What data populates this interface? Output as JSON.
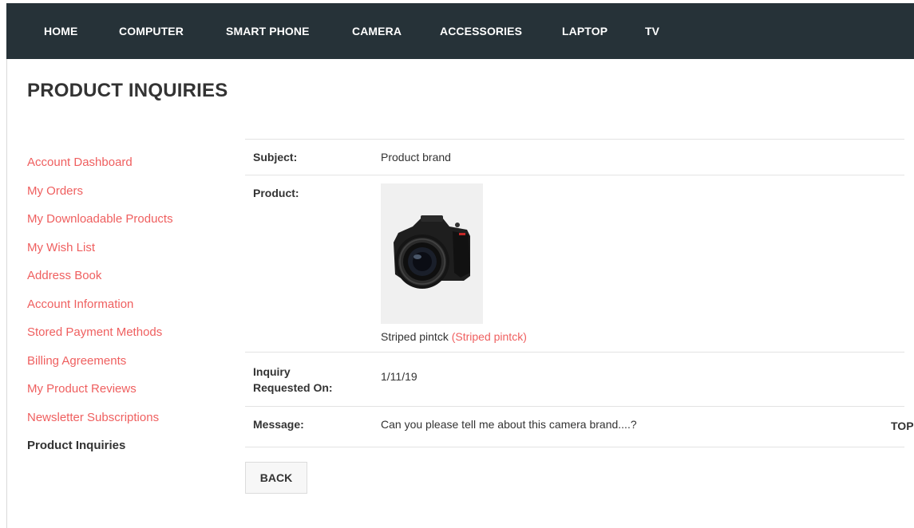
{
  "nav": {
    "items": [
      {
        "label": "HOME"
      },
      {
        "label": "COMPUTER"
      },
      {
        "label": "SMART PHONE"
      },
      {
        "label": "CAMERA"
      },
      {
        "label": "ACCESSORIES"
      },
      {
        "label": "LAPTOP"
      },
      {
        "label": "TV"
      }
    ]
  },
  "page": {
    "title": "PRODUCT INQUIRIES"
  },
  "sidebar": {
    "items": [
      {
        "label": "Account Dashboard"
      },
      {
        "label": "My Orders"
      },
      {
        "label": "My Downloadable Products"
      },
      {
        "label": "My Wish List"
      },
      {
        "label": "Address Book"
      },
      {
        "label": "Account Information"
      },
      {
        "label": "Stored Payment Methods"
      },
      {
        "label": "Billing Agreements"
      },
      {
        "label": "My Product Reviews"
      },
      {
        "label": "Newsletter Subscriptions"
      },
      {
        "label": "Product Inquiries"
      }
    ]
  },
  "inquiry": {
    "subject_label": "Subject:",
    "subject_value": "Product brand",
    "product_label": "Product:",
    "product_name": "Striped pintck",
    "product_link": "(Striped pintck)",
    "date_label_line1": "Inquiry",
    "date_label_line2": "Requested On:",
    "date_value": "1/11/19",
    "message_label": "Message:",
    "message_value": "Can you please tell me about this camera brand....?"
  },
  "actions": {
    "back_label": "BACK",
    "top_label": "TOP"
  },
  "icons": {
    "product_image": "camera-image"
  },
  "colors": {
    "nav_bg": "#263238",
    "link": "#ef5f5f",
    "text": "#333333"
  }
}
